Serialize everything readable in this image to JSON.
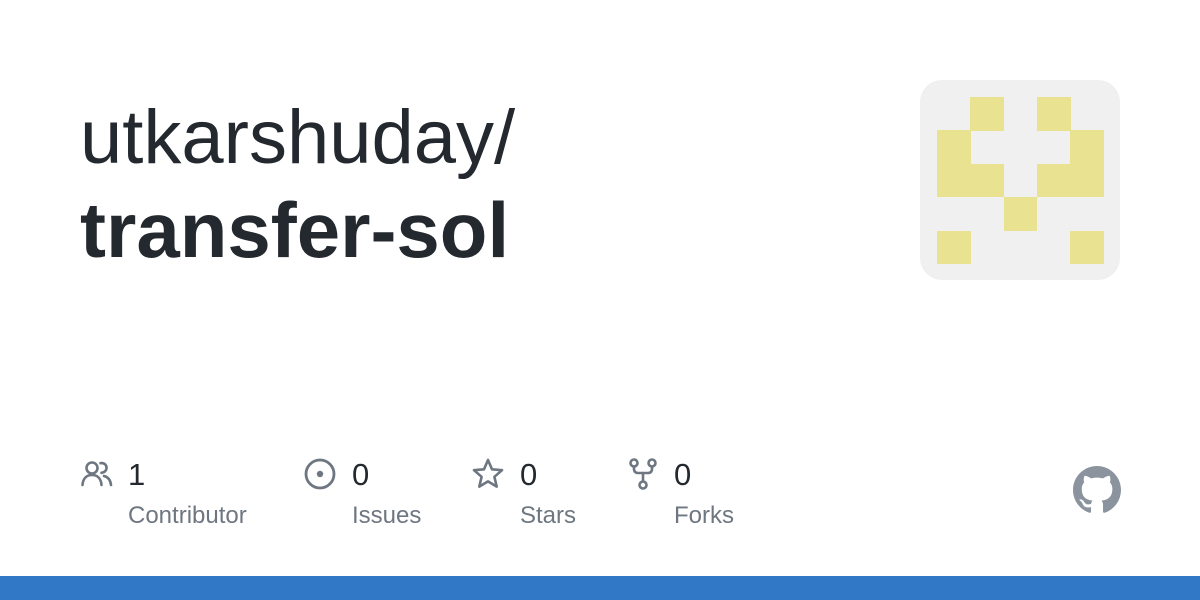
{
  "repo": {
    "owner": "utkarshuday/",
    "name": "transfer-sol"
  },
  "stats": [
    {
      "icon": "people-icon",
      "value": "1",
      "label": "Contributor"
    },
    {
      "icon": "issue-opened-icon",
      "value": "0",
      "label": "Issues"
    },
    {
      "icon": "star-icon",
      "value": "0",
      "label": "Stars"
    },
    {
      "icon": "repo-forked-icon",
      "value": "0",
      "label": "Forks"
    }
  ],
  "colors": {
    "text_primary": "#24292f",
    "text_secondary": "#6e7781",
    "icon": "#6e7781",
    "identicon_bg": "#f0f0f0",
    "identicon_fill": "#e8e291",
    "bottom_bar": "#3178c6",
    "github_logo": "#8b949e"
  },
  "logo": "github-mark-icon"
}
